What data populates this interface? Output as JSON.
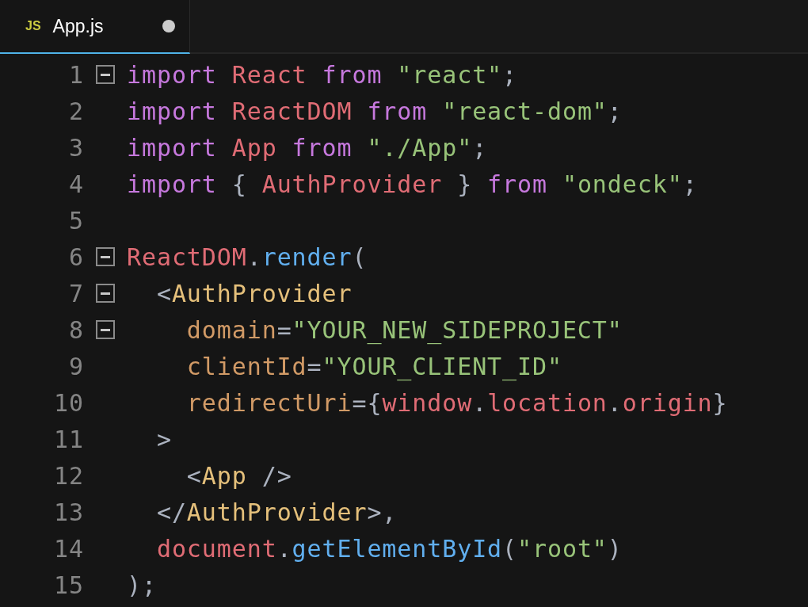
{
  "tabs": [
    {
      "badge": "JS",
      "label": "App.js",
      "modified": true,
      "selected": true
    }
  ],
  "lines": [
    {
      "number": "1",
      "foldable": true,
      "tokens": [
        {
          "text": "import",
          "kind": "keyword"
        },
        {
          "text": " React ",
          "kind": "variable"
        },
        {
          "text": "from",
          "kind": "keyword"
        },
        {
          "text": " \"react\"",
          "kind": "string"
        },
        {
          "text": ";",
          "kind": "punct"
        }
      ]
    },
    {
      "number": "2",
      "foldable": false,
      "tokens": [
        {
          "text": "import",
          "kind": "keyword"
        },
        {
          "text": " ReactDOM ",
          "kind": "variable"
        },
        {
          "text": "from",
          "kind": "keyword"
        },
        {
          "text": " \"react-dom\"",
          "kind": "string"
        },
        {
          "text": ";",
          "kind": "punct"
        }
      ]
    },
    {
      "number": "3",
      "foldable": false,
      "tokens": [
        {
          "text": "import",
          "kind": "keyword"
        },
        {
          "text": " App ",
          "kind": "variable"
        },
        {
          "text": "from",
          "kind": "keyword"
        },
        {
          "text": " \"./App\"",
          "kind": "string"
        },
        {
          "text": ";",
          "kind": "punct"
        }
      ]
    },
    {
      "number": "4",
      "foldable": false,
      "tokens": [
        {
          "text": "import",
          "kind": "keyword"
        },
        {
          "text": " { ",
          "kind": "punct"
        },
        {
          "text": "AuthProvider",
          "kind": "variable"
        },
        {
          "text": " } ",
          "kind": "punct"
        },
        {
          "text": "from",
          "kind": "keyword"
        },
        {
          "text": " \"ondeck\"",
          "kind": "string"
        },
        {
          "text": ";",
          "kind": "punct"
        }
      ]
    },
    {
      "number": "5",
      "foldable": false
    },
    {
      "number": "6",
      "foldable": true,
      "tokens": [
        {
          "text": "ReactDOM",
          "kind": "variable"
        },
        {
          "text": ".",
          "kind": "punct"
        },
        {
          "text": "render",
          "kind": "function"
        },
        {
          "text": "(",
          "kind": "punct"
        }
      ]
    },
    {
      "number": "7",
      "foldable": true,
      "tokens": [
        {
          "text": "  <",
          "kind": "punct"
        },
        {
          "text": "AuthProvider",
          "kind": "tag"
        }
      ]
    },
    {
      "number": "8",
      "foldable": true,
      "tokens": [
        {
          "text": "    domain",
          "kind": "attr"
        },
        {
          "text": "=",
          "kind": "punct"
        },
        {
          "text": "\"YOUR_NEW_SIDEPROJECT\"",
          "kind": "string"
        }
      ]
    },
    {
      "number": "9",
      "foldable": false,
      "tokens": [
        {
          "text": "    clientId",
          "kind": "attr"
        },
        {
          "text": "=",
          "kind": "punct"
        },
        {
          "text": "\"YOUR_CLIENT_ID\"",
          "kind": "string"
        }
      ]
    },
    {
      "number": "10",
      "foldable": false,
      "tokens": [
        {
          "text": "    redirectUri",
          "kind": "attr"
        },
        {
          "text": "={",
          "kind": "punct"
        },
        {
          "text": "window",
          "kind": "variable"
        },
        {
          "text": ".",
          "kind": "punct"
        },
        {
          "text": "location",
          "kind": "variable"
        },
        {
          "text": ".",
          "kind": "punct"
        },
        {
          "text": "origin",
          "kind": "variable"
        },
        {
          "text": "}",
          "kind": "punct"
        }
      ]
    },
    {
      "number": "11",
      "foldable": false,
      "tokens": [
        {
          "text": "  >",
          "kind": "punct"
        }
      ]
    },
    {
      "number": "12",
      "foldable": false,
      "tokens": [
        {
          "text": "    <",
          "kind": "punct"
        },
        {
          "text": "App",
          "kind": "tag"
        },
        {
          "text": " />",
          "kind": "punct"
        }
      ]
    },
    {
      "number": "13",
      "foldable": false,
      "tokens": [
        {
          "text": "  </",
          "kind": "punct"
        },
        {
          "text": "AuthProvider",
          "kind": "tag"
        },
        {
          "text": ">,",
          "kind": "punct"
        }
      ]
    },
    {
      "number": "14",
      "foldable": false,
      "tokens": [
        {
          "text": "  document",
          "kind": "variable"
        },
        {
          "text": ".",
          "kind": "punct"
        },
        {
          "text": "getElementById",
          "kind": "function"
        },
        {
          "text": "(",
          "kind": "punct"
        },
        {
          "text": "\"root\"",
          "kind": "string"
        },
        {
          "text": ")",
          "kind": "punct"
        }
      ]
    },
    {
      "number": "15",
      "foldable": false,
      "tokens": [
        {
          "text": ");",
          "kind": "punct"
        }
      ]
    }
  ]
}
